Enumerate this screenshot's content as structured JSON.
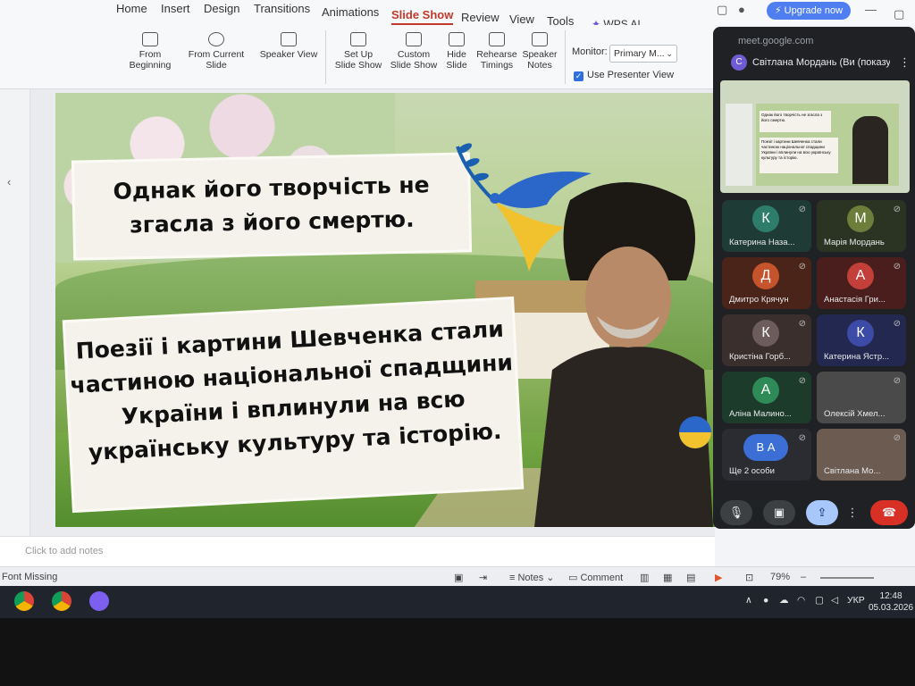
{
  "menu": {
    "items": [
      "Home",
      "Insert",
      "Design",
      "Transitions",
      "Animations",
      "Slide Show",
      "Review",
      "View",
      "Tools"
    ],
    "active": "Slide Show",
    "wps_ai": "WPS AI",
    "upgrade": "Upgrade now"
  },
  "ribbon": {
    "from_beginning": "From Beginning",
    "from_current": "From Current Slide",
    "speaker_view": "Speaker View",
    "set_up": "Set Up Slide Show",
    "custom": "Custom Slide Show",
    "hide_slide": "Hide Slide",
    "rehearse": "Rehearse Timings",
    "speaker_notes": "Speaker Notes",
    "monitor_label": "Monitor:",
    "monitor_value": "Primary M...",
    "presenter_view": "Use Presenter View"
  },
  "slide": {
    "line1": "Однак його творчість не згасла з його смертю.",
    "line2": "Поезії і картини Шевченка стали частиною національної спадщини України і вплинули на всю українську культуру та історію."
  },
  "notes": {
    "placeholder": "Click to add notes"
  },
  "status": {
    "font_missing": "Font Missing",
    "notes": "Notes",
    "comment": "Comment",
    "zoom": "79%"
  },
  "meet": {
    "url": "meet.google.com",
    "presenter_initial": "С",
    "presenter": "Світлана Мордань (Ви (показуєте))",
    "mini_line1": "Однак його творчість не згасла з його смертю.",
    "mini_line2": "Поезії і картини Шевченка стали частиною національної спадщини України і вплинули на всю українську культуру та історію.",
    "participants": [
      {
        "initial": "К",
        "name": "Катерина Наза...",
        "color": "#2e7d6b",
        "tile": "#1f3b35"
      },
      {
        "initial": "М",
        "name": "Марія Мордань",
        "color": "#6b7f3a",
        "tile": "#2b3322"
      },
      {
        "initial": "Д",
        "name": "Дмитро Крячун",
        "color": "#c5532c",
        "tile": "#4a2418"
      },
      {
        "initial": "А",
        "name": "Анастасія Гри...",
        "color": "#c23f3a",
        "tile": "#4a1e1c"
      },
      {
        "initial": "К",
        "name": "Кристіна Горб...",
        "color": "#6d5d5a",
        "tile": "#3a2f2d"
      },
      {
        "initial": "К",
        "name": "Катерина Ястр...",
        "color": "#3d4ba8",
        "tile": "#22284f"
      },
      {
        "initial": "А",
        "name": "Аліна Малино...",
        "color": "#2e8b57",
        "tile": "#1c3b2b"
      },
      {
        "initial": "",
        "name": "Олексій Хмел...",
        "color": "#5a4a3a",
        "tile": "#4a4a4a"
      },
      {
        "initial": "В А",
        "name": "Ще 2 особи",
        "color": "#3b6fd6",
        "tile": "#2a2c31"
      },
      {
        "initial": "",
        "name": "Світлана Мо...",
        "color": "#b59a83",
        "tile": "#6b5b50"
      }
    ]
  },
  "taskbar": {
    "lang": "УКР",
    "time": "12:48",
    "date": "05.03.2026"
  }
}
